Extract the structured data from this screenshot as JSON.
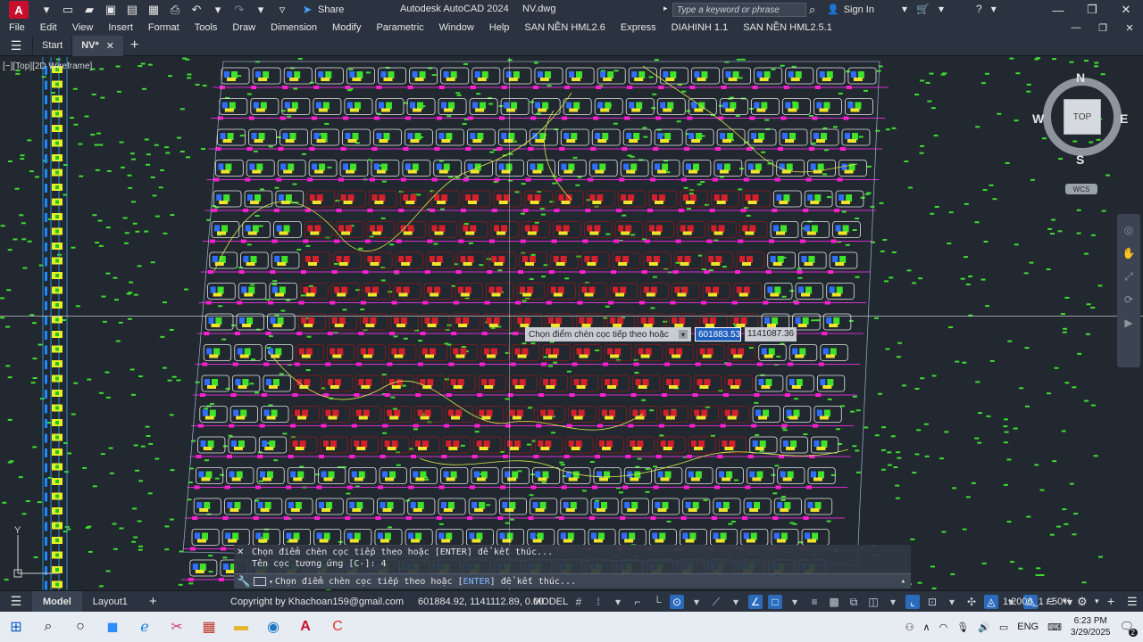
{
  "app": {
    "window_title": "Autodesk AutoCAD 2024",
    "file_name": "NV.dwg",
    "logo_letter": "A",
    "share_label": "Share",
    "search_placeholder": "Type a keyword or phrase",
    "sign_in_label": "Sign In"
  },
  "menu": [
    "File",
    "Edit",
    "View",
    "Insert",
    "Format",
    "Tools",
    "Draw",
    "Dimension",
    "Modify",
    "Parametric",
    "Window",
    "Help",
    "SAN NỀN HML2.6",
    "Express",
    "DIAHINH 1.1",
    "SAN NỀN HML2.5.1"
  ],
  "file_tabs": [
    {
      "label": "Start",
      "active": false
    },
    {
      "label": "NV*",
      "active": true
    }
  ],
  "viewport": {
    "label": "[−][Top][2D Wireframe]",
    "tooltip_prompt": "Chọn điểm chèn cọc tiếp theo hoặc",
    "tooltip_x": "601883.53",
    "tooltip_y": "1141087.36"
  },
  "viewcube": {
    "north": "N",
    "south": "S",
    "east": "E",
    "west": "W",
    "face": "TOP",
    "wcs": "WCS"
  },
  "ucs": {
    "y_label": "Y"
  },
  "command": {
    "history": [
      "Chọn điểm chèn cọc tiếp theo hoặc [ENTER] để kết thúc...",
      "Tên cọc tương ứng [C-]: 4"
    ],
    "prompt_prefix": "Chọn điểm chèn cọc tiếp theo hoặc [",
    "prompt_keyword": "ENTER",
    "prompt_suffix": "] để kết thúc..."
  },
  "status": {
    "layout_tabs": [
      {
        "label": "Model",
        "active": true
      },
      {
        "label": "Layout1",
        "active": false
      }
    ],
    "copyright": "Copyright by Khachoan159@gmail.com",
    "coordinates": "601884.92, 1141112.89, 0.00",
    "mode": "MODEL",
    "scale": "1:2000_1 / 50%"
  },
  "taskbar": {
    "language": "ENG",
    "time": "6:23 PM",
    "date": "3/29/2025",
    "notification_count": "2"
  },
  "colors": {
    "ribbon_bg": "#2b3340",
    "canvas_bg": "#212830",
    "accent_blue": "#2a6bbd",
    "autocad_red": "#c8102e"
  }
}
